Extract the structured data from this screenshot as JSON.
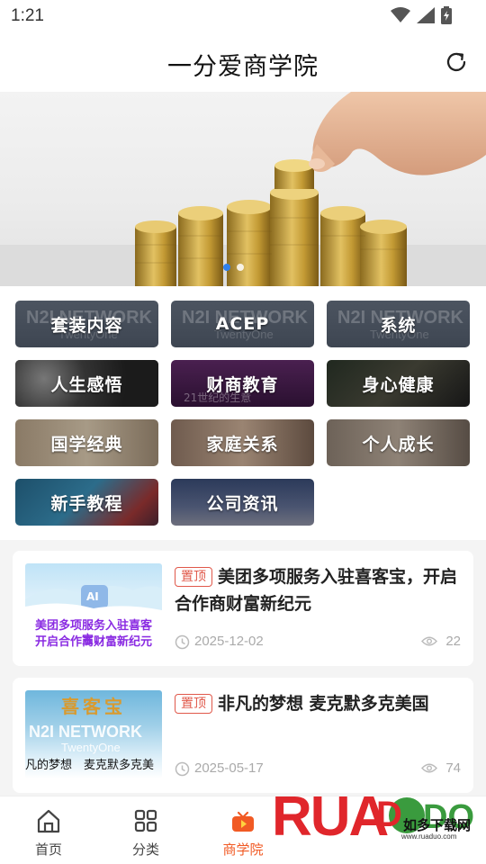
{
  "status_bar": {
    "time": "1:21"
  },
  "header": {
    "title": "一分爱商学院"
  },
  "banner": {
    "slide_count": 2,
    "active_slide": 1
  },
  "categories": [
    {
      "label": "套装内容",
      "style": "network"
    },
    {
      "label": "ACEP",
      "style": "network"
    },
    {
      "label": "系统",
      "style": "network"
    },
    {
      "label": "人生感悟",
      "style": "photo-dark"
    },
    {
      "label": "财商教育",
      "style": "photo-purple"
    },
    {
      "label": "身心健康",
      "style": "photo-dark"
    },
    {
      "label": "国学经典",
      "style": "photo-light"
    },
    {
      "label": "家庭关系",
      "style": "photo-mid"
    },
    {
      "label": "个人成长",
      "style": "photo-mid"
    },
    {
      "label": "新手教程",
      "style": "photo-blue"
    },
    {
      "label": "公司资讯",
      "style": "photo-news"
    }
  ],
  "category_images": {
    "network_brand": "N2I NETWORK",
    "network_sub": "TwentyOne",
    "caishang_caption": "21世纪的生意"
  },
  "news": [
    {
      "badge": "置顶",
      "title": "美团多项服务入驻喜客宝，开启合作商财富新纪元",
      "date": "2025-12-02",
      "views": "22",
      "thumb_line1": "美团多项服务入驻喜客宝，",
      "thumb_line2": "开启合作商财富新纪元",
      "thumb_tag": "AI"
    },
    {
      "badge": "置顶",
      "title": "非凡的梦想 麦克默多克美国",
      "date": "2025-05-17",
      "views": "74",
      "thumb_brand": "喜客宝",
      "thumb_network": "N2I NETWORK",
      "thumb_sub": "TwentyOne",
      "thumb_caption": "凡的梦想　麦克默多克美"
    }
  ],
  "bottom_nav": [
    {
      "label": "首页",
      "icon": "home-icon",
      "active": false
    },
    {
      "label": "分类",
      "icon": "grid-icon",
      "active": false
    },
    {
      "label": "商学院",
      "icon": "tv-icon",
      "active": true
    }
  ],
  "watermark": {
    "brand": "RUANDAO",
    "sub": "如多下载网",
    "url": "www.ruaduo.com"
  },
  "colors": {
    "accent": "#f15a24",
    "badge": "#e0584a",
    "banner_dot_active": "#2f80ed"
  }
}
